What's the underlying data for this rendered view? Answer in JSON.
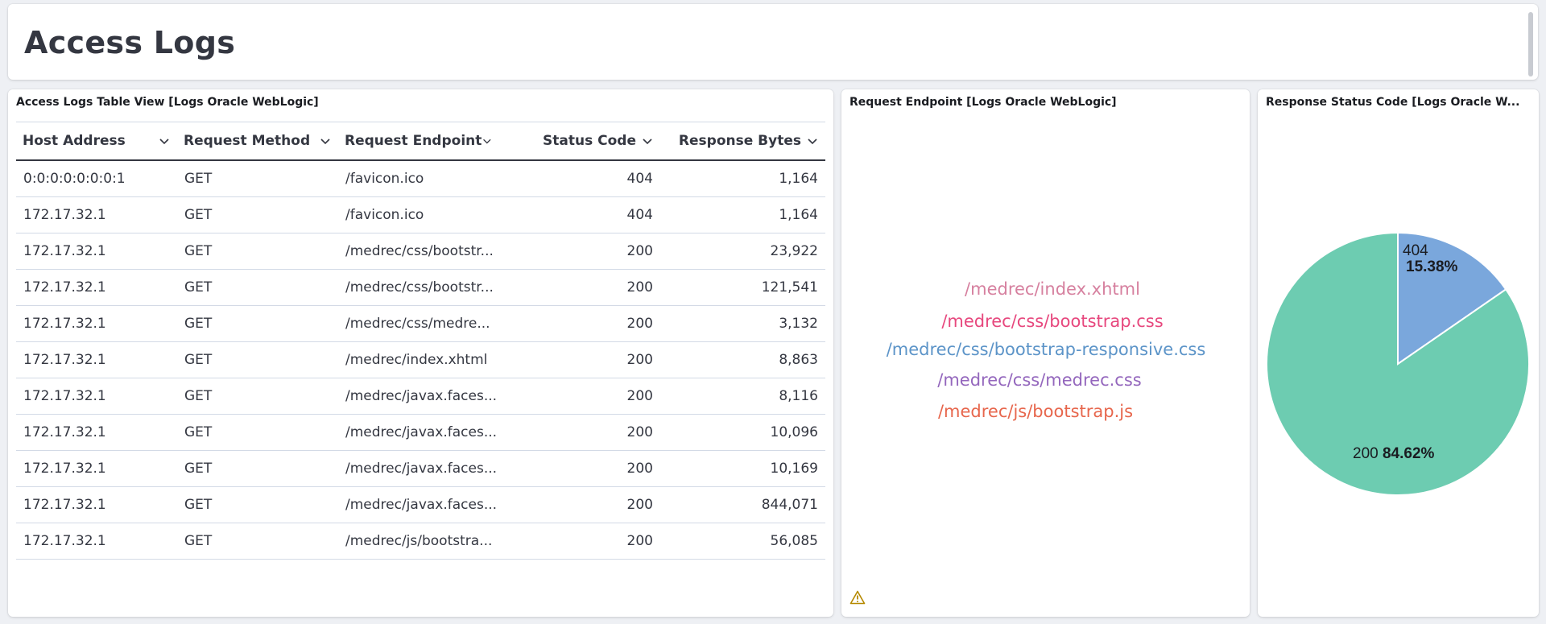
{
  "page": {
    "title": "Access Logs"
  },
  "table_panel": {
    "title": "Access Logs Table View [Logs Oracle WebLogic]",
    "columns": [
      "Host Address",
      "Request Method",
      "Request Endpoint",
      "Status Code",
      "Response Bytes"
    ],
    "rows": [
      [
        "0:0:0:0:0:0:0:1",
        "GET",
        "/favicon.ico",
        "404",
        "1,164"
      ],
      [
        "172.17.32.1",
        "GET",
        "/favicon.ico",
        "404",
        "1,164"
      ],
      [
        "172.17.32.1",
        "GET",
        "/medrec/css/bootstr...",
        "200",
        "23,922"
      ],
      [
        "172.17.32.1",
        "GET",
        "/medrec/css/bootstr...",
        "200",
        "121,541"
      ],
      [
        "172.17.32.1",
        "GET",
        "/medrec/css/medre...",
        "200",
        "3,132"
      ],
      [
        "172.17.32.1",
        "GET",
        "/medrec/index.xhtml",
        "200",
        "8,863"
      ],
      [
        "172.17.32.1",
        "GET",
        "/medrec/javax.faces...",
        "200",
        "8,116"
      ],
      [
        "172.17.32.1",
        "GET",
        "/medrec/javax.faces...",
        "200",
        "10,096"
      ],
      [
        "172.17.32.1",
        "GET",
        "/medrec/javax.faces...",
        "200",
        "10,169"
      ],
      [
        "172.17.32.1",
        "GET",
        "/medrec/javax.faces...",
        "200",
        "844,071"
      ],
      [
        "172.17.32.1",
        "GET",
        "/medrec/js/bootstra...",
        "200",
        "56,085"
      ]
    ]
  },
  "endpoint_panel": {
    "title": "Request Endpoint [Logs Oracle WebLogic]",
    "tags": [
      {
        "text": "/medrec/index.xhtml",
        "color": "#d6809f"
      },
      {
        "text": "/medrec/css/bootstrap.css",
        "color": "#e7487e"
      },
      {
        "text": "/medrec/css/bootstrap-responsive.css",
        "color": "#5c94c8"
      },
      {
        "text": "/medrec/css/medrec.css",
        "color": "#9467bd"
      },
      {
        "text": "/medrec/js/bootstrap.js",
        "color": "#e7664c"
      }
    ],
    "warning_icon": "warning-icon"
  },
  "status_panel": {
    "title": "Response Status Code [Logs Oracle W...",
    "chart_data": {
      "type": "pie",
      "slices": [
        {
          "label": "404",
          "percent_label": "15.38%",
          "value": 15.38,
          "color": "#7aa7dc"
        },
        {
          "label": "200",
          "percent_label": "84.62%",
          "value": 84.62,
          "color": "#6dccb1"
        }
      ]
    }
  }
}
